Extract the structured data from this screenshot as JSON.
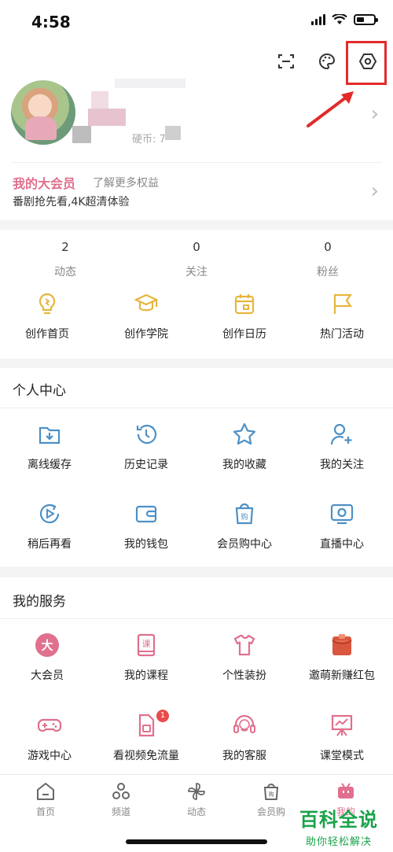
{
  "status": {
    "time": "4:58"
  },
  "profile": {
    "coin_text": "硬币: 7",
    "vip_title": "我的大会员",
    "vip_more": "了解更多权益",
    "vip_subtitle": "番剧抢先看,4K超清体验"
  },
  "stats": [
    {
      "value": "2",
      "label": "动态"
    },
    {
      "value": "0",
      "label": "关注"
    },
    {
      "value": "0",
      "label": "粉丝"
    }
  ],
  "creator": [
    {
      "label": "创作首页",
      "icon": "lightbulb-icon"
    },
    {
      "label": "创作学院",
      "icon": "graduation-cap-icon"
    },
    {
      "label": "创作日历",
      "icon": "calendar-icon"
    },
    {
      "label": "热门活动",
      "icon": "flag-icon"
    }
  ],
  "personal": {
    "title": "个人中心",
    "items": [
      {
        "label": "离线缓存",
        "icon": "download-folder-icon"
      },
      {
        "label": "历史记录",
        "icon": "history-clock-icon"
      },
      {
        "label": "我的收藏",
        "icon": "star-icon"
      },
      {
        "label": "我的关注",
        "icon": "add-user-icon"
      },
      {
        "label": "稍后再看",
        "icon": "play-later-icon"
      },
      {
        "label": "我的钱包",
        "icon": "wallet-icon"
      },
      {
        "label": "会员购中心",
        "icon": "shopping-bag-icon"
      },
      {
        "label": "直播中心",
        "icon": "live-tv-icon"
      }
    ]
  },
  "services": {
    "title": "我的服务",
    "items": [
      {
        "label": "大会员",
        "icon": "vip-icon",
        "icon_text": "大"
      },
      {
        "label": "我的课程",
        "icon": "course-book-icon",
        "icon_text": "课"
      },
      {
        "label": "个性装扮",
        "icon": "tshirt-icon"
      },
      {
        "label": "邀萌新赚红包",
        "icon": "red-envelope-icon"
      },
      {
        "label": "游戏中心",
        "icon": "gamepad-icon"
      },
      {
        "label": "看视频免流量",
        "icon": "sim-card-icon",
        "badge": "1"
      },
      {
        "label": "我的客服",
        "icon": "headset-icon"
      },
      {
        "label": "课堂模式",
        "icon": "classroom-board-icon"
      }
    ]
  },
  "tabbar": [
    {
      "label": "首页",
      "icon": "home-icon"
    },
    {
      "label": "频道",
      "icon": "channels-icon"
    },
    {
      "label": "动态",
      "icon": "pinwheel-icon"
    },
    {
      "label": "会员购",
      "icon": "shop-bag-icon"
    },
    {
      "label": "我的",
      "icon": "tv-mascot-icon"
    }
  ],
  "watermark": {
    "main": "百科全说",
    "sub": "助你轻松解决"
  },
  "colors": {
    "accent_pink": "#e0708d",
    "icon_blue": "#4d90c6",
    "icon_gold": "#e7b53e",
    "highlight_red": "#e12b2b",
    "watermark_green": "#1aa34a"
  }
}
